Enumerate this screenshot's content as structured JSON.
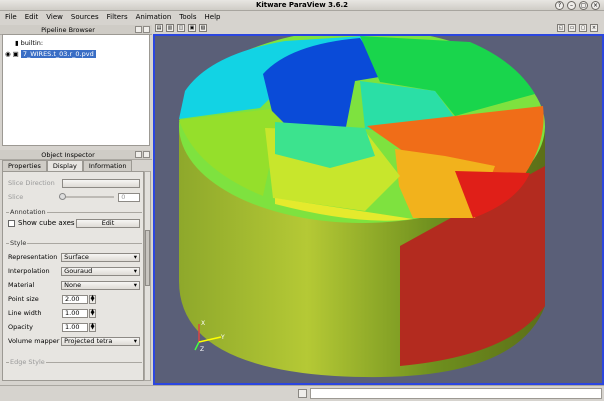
{
  "window": {
    "title": "Kitware ParaView 3.6.2"
  },
  "menu": [
    "File",
    "Edit",
    "View",
    "Sources",
    "Filters",
    "Animation",
    "Tools",
    "Help"
  ],
  "pipeline": {
    "title": "Pipeline Browser",
    "items": [
      {
        "label": "builtin:"
      },
      {
        "label": "7_WIRES.t_03.r_0.pvd"
      }
    ]
  },
  "inspector": {
    "title": "Object Inspector",
    "tabs": [
      "Properties",
      "Display",
      "Information"
    ],
    "active_tab": "Display"
  },
  "display": {
    "slice_direction_label": "Slice Direction",
    "slice_label": "Slice",
    "slice_value": "0",
    "annotation_label": "Annotation",
    "show_cube_axes_label": "Show cube axes",
    "edit_label": "Edit",
    "style_label": "Style",
    "representation_label": "Representation",
    "representation_value": "Surface",
    "interpolation_label": "Interpolation",
    "interpolation_value": "Gouraud",
    "material_label": "Material",
    "material_value": "None",
    "point_size_label": "Point size",
    "point_size_value": "2.00",
    "line_width_label": "Line width",
    "line_width_value": "1.00",
    "opacity_label": "Opacity",
    "opacity_value": "1.00",
    "volume_mapper_label": "Volume mapper",
    "volume_mapper_value": "Projected tetra",
    "edge_style_label": "Edge Style"
  },
  "axes": {
    "x": "X",
    "y": "Y",
    "z": "Z"
  },
  "colors": {
    "viewport": "#5a5f78",
    "selection": "#3a6ec5"
  }
}
